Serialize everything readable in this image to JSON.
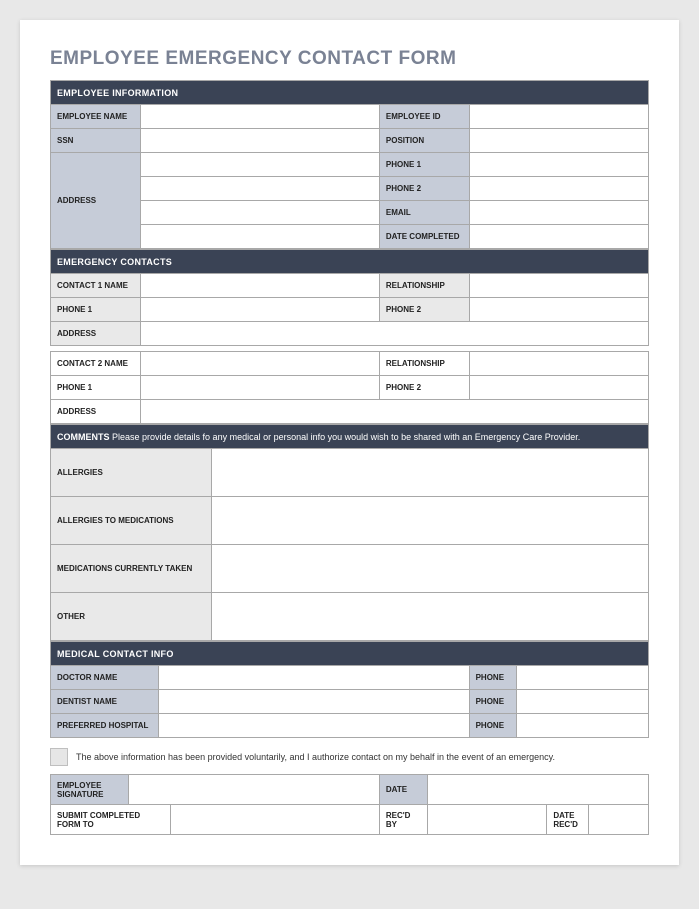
{
  "title": "EMPLOYEE EMERGENCY CONTACT FORM",
  "sections": {
    "employeeInfo": {
      "header": "EMPLOYEE INFORMATION",
      "labels": {
        "name": "EMPLOYEE NAME",
        "id": "EMPLOYEE ID",
        "ssn": "SSN",
        "position": "POSITION",
        "address": "ADDRESS",
        "phone1": "PHONE 1",
        "phone2": "PHONE 2",
        "email": "EMAIL",
        "dateCompleted": "DATE COMPLETED"
      }
    },
    "emergencyContacts": {
      "header": "EMERGENCY CONTACTS",
      "labels": {
        "contact1": "CONTACT 1 NAME",
        "contact2": "CONTACT 2 NAME",
        "relationship": "RELATIONSHIP",
        "phone1": "PHONE 1",
        "phone2": "PHONE 2",
        "address": "ADDRESS"
      }
    },
    "comments": {
      "headerBold": "COMMENTS",
      "headerText": " Please provide details fo any medical or personal info you would wish to be shared with an Emergency Care Provider.",
      "labels": {
        "allergies": "ALLERGIES",
        "allergiesToMeds": "ALLERGIES TO MEDICATIONS",
        "medsCurrently": "MEDICATIONS CURRENTLY TAKEN",
        "other": "OTHER"
      }
    },
    "medicalContact": {
      "header": "MEDICAL CONTACT INFO",
      "labels": {
        "doctor": "DOCTOR NAME",
        "dentist": "DENTIST NAME",
        "hospital": "PREFERRED HOSPITAL",
        "phone": "PHONE"
      }
    },
    "authorization": {
      "text": "The above information has been provided voluntarily, and I authorize contact on my behalf in the event of an emergency."
    },
    "signature": {
      "labels": {
        "employeeSig": "EMPLOYEE SIGNATURE",
        "date": "DATE",
        "submitTo": "SUBMIT COMPLETED FORM TO",
        "recdBy": "REC'D BY",
        "dateRecd": "DATE REC'D"
      }
    }
  }
}
